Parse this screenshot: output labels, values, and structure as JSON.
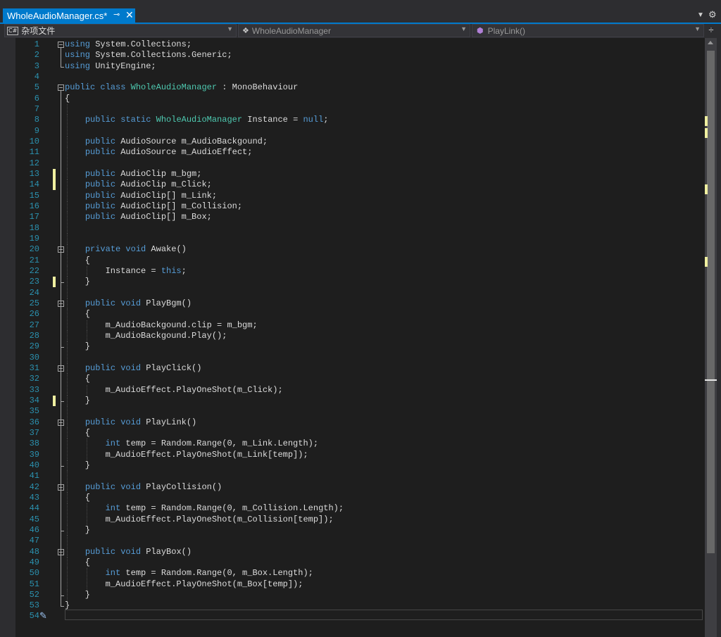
{
  "tab": {
    "title": "WholeAudioManager.cs*",
    "pin_icon": "pin-icon",
    "close_icon": "close-icon"
  },
  "navbar": {
    "project": "杂项文件",
    "project_badge": "C#",
    "class": "WholeAudioManager",
    "member": "PlayLink()"
  },
  "colors": {
    "accent": "#007acc",
    "keyword": "#569cd6",
    "type": "#4ec9b0",
    "line_number": "#2b91af",
    "change_saved": "#efefa0",
    "editor_bg": "#1e1e1e"
  },
  "editor": {
    "lines": [
      {
        "n": "1",
        "segs": [
          [
            "kw",
            "using"
          ],
          [
            "t",
            " System.Collections;"
          ]
        ]
      },
      {
        "n": "2",
        "segs": [
          [
            "kw",
            "using"
          ],
          [
            "t",
            " System.Collections.Generic;"
          ]
        ]
      },
      {
        "n": "3",
        "segs": [
          [
            "kw",
            "using"
          ],
          [
            "t",
            " UnityEngine;"
          ]
        ]
      },
      {
        "n": "4",
        "segs": []
      },
      {
        "n": "5",
        "segs": [
          [
            "kw",
            "public class "
          ],
          [
            "ty",
            "WholeAudioManager"
          ],
          [
            "t",
            " : MonoBehaviour"
          ]
        ]
      },
      {
        "n": "6",
        "segs": [
          [
            "t",
            "{"
          ]
        ]
      },
      {
        "n": "7",
        "segs": []
      },
      {
        "n": "8",
        "segs": [
          [
            "t",
            "    "
          ],
          [
            "kw",
            "public static "
          ],
          [
            "ty",
            "WholeAudioManager"
          ],
          [
            "t",
            " Instance = "
          ],
          [
            "kw",
            "null"
          ],
          [
            "t",
            ";"
          ]
        ]
      },
      {
        "n": "9",
        "segs": []
      },
      {
        "n": "10",
        "segs": [
          [
            "t",
            "    "
          ],
          [
            "kw",
            "public"
          ],
          [
            "t",
            " AudioSource m_AudioBackgound;"
          ]
        ]
      },
      {
        "n": "11",
        "segs": [
          [
            "t",
            "    "
          ],
          [
            "kw",
            "public"
          ],
          [
            "t",
            " AudioSource m_AudioEffect;"
          ]
        ]
      },
      {
        "n": "12",
        "segs": []
      },
      {
        "n": "13",
        "segs": [
          [
            "t",
            "    "
          ],
          [
            "kw",
            "public"
          ],
          [
            "t",
            " AudioClip m_bgm;"
          ]
        ]
      },
      {
        "n": "14",
        "segs": [
          [
            "t",
            "    "
          ],
          [
            "kw",
            "public"
          ],
          [
            "t",
            " AudioClip m_Click;"
          ]
        ]
      },
      {
        "n": "15",
        "segs": [
          [
            "t",
            "    "
          ],
          [
            "kw",
            "public"
          ],
          [
            "t",
            " AudioClip[] m_Link;"
          ]
        ]
      },
      {
        "n": "16",
        "segs": [
          [
            "t",
            "    "
          ],
          [
            "kw",
            "public"
          ],
          [
            "t",
            " AudioClip[] m_Collision;"
          ]
        ]
      },
      {
        "n": "17",
        "segs": [
          [
            "t",
            "    "
          ],
          [
            "kw",
            "public"
          ],
          [
            "t",
            " AudioClip[] m_Box;"
          ]
        ]
      },
      {
        "n": "18",
        "segs": []
      },
      {
        "n": "19",
        "segs": []
      },
      {
        "n": "20",
        "segs": [
          [
            "t",
            "    "
          ],
          [
            "kw",
            "private void"
          ],
          [
            "t",
            " Awake()"
          ]
        ]
      },
      {
        "n": "21",
        "segs": [
          [
            "t",
            "    {"
          ]
        ]
      },
      {
        "n": "22",
        "segs": [
          [
            "t",
            "        Instance = "
          ],
          [
            "kw",
            "this"
          ],
          [
            "t",
            ";"
          ]
        ]
      },
      {
        "n": "23",
        "segs": [
          [
            "t",
            "    }"
          ]
        ]
      },
      {
        "n": "24",
        "segs": []
      },
      {
        "n": "25",
        "segs": [
          [
            "t",
            "    "
          ],
          [
            "kw",
            "public void"
          ],
          [
            "t",
            " PlayBgm()"
          ]
        ]
      },
      {
        "n": "26",
        "segs": [
          [
            "t",
            "    {"
          ]
        ]
      },
      {
        "n": "27",
        "segs": [
          [
            "t",
            "        m_AudioBackgound.clip = m_bgm;"
          ]
        ]
      },
      {
        "n": "28",
        "segs": [
          [
            "t",
            "        m_AudioBackgound.Play();"
          ]
        ]
      },
      {
        "n": "29",
        "segs": [
          [
            "t",
            "    }"
          ]
        ]
      },
      {
        "n": "30",
        "segs": []
      },
      {
        "n": "31",
        "segs": [
          [
            "t",
            "    "
          ],
          [
            "kw",
            "public void"
          ],
          [
            "t",
            " PlayClick()"
          ]
        ]
      },
      {
        "n": "32",
        "segs": [
          [
            "t",
            "    {"
          ]
        ]
      },
      {
        "n": "33",
        "segs": [
          [
            "t",
            "        m_AudioEffect.PlayOneShot(m_Click);"
          ]
        ]
      },
      {
        "n": "34",
        "segs": [
          [
            "t",
            "    }"
          ]
        ]
      },
      {
        "n": "35",
        "segs": []
      },
      {
        "n": "36",
        "segs": [
          [
            "t",
            "    "
          ],
          [
            "kw",
            "public void"
          ],
          [
            "t",
            " PlayLink()"
          ]
        ]
      },
      {
        "n": "37",
        "segs": [
          [
            "t",
            "    {"
          ]
        ]
      },
      {
        "n": "38",
        "segs": [
          [
            "t",
            "        "
          ],
          [
            "kw",
            "int"
          ],
          [
            "t",
            " temp = Random.Range(0, m_Link.Length);"
          ]
        ]
      },
      {
        "n": "39",
        "segs": [
          [
            "t",
            "        m_AudioEffect.PlayOneShot(m_Link[temp]);"
          ]
        ]
      },
      {
        "n": "40",
        "segs": [
          [
            "t",
            "    }"
          ]
        ]
      },
      {
        "n": "41",
        "segs": []
      },
      {
        "n": "42",
        "segs": [
          [
            "t",
            "    "
          ],
          [
            "kw",
            "public void"
          ],
          [
            "t",
            " PlayCollision()"
          ]
        ]
      },
      {
        "n": "43",
        "segs": [
          [
            "t",
            "    {"
          ]
        ]
      },
      {
        "n": "44",
        "segs": [
          [
            "t",
            "        "
          ],
          [
            "kw",
            "int"
          ],
          [
            "t",
            " temp = Random.Range(0, m_Collision.Length);"
          ]
        ]
      },
      {
        "n": "45",
        "segs": [
          [
            "t",
            "        m_AudioEffect.PlayOneShot(m_Collision[temp]);"
          ]
        ]
      },
      {
        "n": "46",
        "segs": [
          [
            "t",
            "    }"
          ]
        ]
      },
      {
        "n": "47",
        "segs": []
      },
      {
        "n": "48",
        "segs": [
          [
            "t",
            "    "
          ],
          [
            "kw",
            "public void"
          ],
          [
            "t",
            " PlayBox()"
          ]
        ]
      },
      {
        "n": "49",
        "segs": [
          [
            "t",
            "    {"
          ]
        ]
      },
      {
        "n": "50",
        "segs": [
          [
            "t",
            "        "
          ],
          [
            "kw",
            "int"
          ],
          [
            "t",
            " temp = Random.Range(0, m_Box.Length);"
          ]
        ]
      },
      {
        "n": "51",
        "segs": [
          [
            "t",
            "        m_AudioEffect.PlayOneShot(m_Box[temp]);"
          ]
        ]
      },
      {
        "n": "52",
        "segs": [
          [
            "t",
            "    }"
          ]
        ]
      },
      {
        "n": "53",
        "segs": [
          [
            "t",
            "}"
          ]
        ]
      },
      {
        "n": "54",
        "segs": []
      }
    ],
    "fold_lines": [
      "1",
      "5",
      "20",
      "25",
      "31",
      "36",
      "42",
      "48"
    ],
    "changed_lines": [
      "13",
      "14",
      "23",
      "34"
    ],
    "last_line_icon": "brush-icon"
  },
  "scrollbar": {
    "change_marks_fraction": [
      0.13,
      0.15,
      0.245,
      0.365
    ],
    "position_fraction": 0.57
  }
}
